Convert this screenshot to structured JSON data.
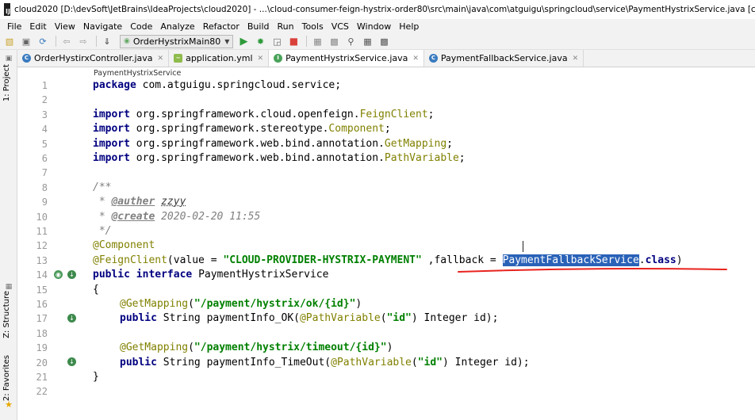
{
  "window": {
    "title": "cloud2020 [D:\\devSoft\\JetBrains\\IdeaProjects\\cloud2020] - ...\\cloud-consumer-feign-hystrix-order80\\src\\main\\java\\com\\atguigu\\springcloud\\service\\PaymentHystrixService.java [cloud-con"
  },
  "menu": [
    "File",
    "Edit",
    "View",
    "Navigate",
    "Code",
    "Analyze",
    "Refactor",
    "Build",
    "Run",
    "Tools",
    "VCS",
    "Window",
    "Help"
  ],
  "toolbar": {
    "run_config": "OrderHystrixMain80",
    "icons": [
      "open-folder-icon",
      "save-icon",
      "sync-icon",
      "back-arrow-icon",
      "forward-arrow-icon",
      "build-icon",
      "run-icon",
      "debug-icon",
      "coverage-icon",
      "stop-icon",
      "project-structure-icon",
      "sdk-icon",
      "search-icon",
      "grid-icon",
      "terminal-icon"
    ]
  },
  "side_tabs": {
    "project": "1: Project",
    "structure": "Z: Structure",
    "favorites": "2: Favorites"
  },
  "tabs": [
    {
      "label": "OrderHystirxController.java",
      "icon": "class-icon",
      "active": false
    },
    {
      "label": "application.yml",
      "icon": "yaml-icon",
      "active": false
    },
    {
      "label": "PaymentHystrixService.java",
      "icon": "interface-icon",
      "active": true
    },
    {
      "label": "PaymentFallbackService.java",
      "icon": "class-icon",
      "active": false
    }
  ],
  "breadcrumb": "PaymentHystrixService",
  "line_numbers": [
    "1",
    "2",
    "3",
    "4",
    "5",
    "6",
    "7",
    "8",
    "9",
    "10",
    "11",
    "12",
    "13",
    "14",
    "15",
    "16",
    "17",
    "18",
    "19",
    "20",
    "21",
    "22"
  ],
  "code": {
    "l1_kw": "package",
    "l1_rest": " com.atguigu.springcloud.service;",
    "imp": "import",
    "l3_a": " org.springframework.cloud.openfeign.",
    "l3_b": "FeignClient",
    "l3_c": ";",
    "l4_a": " org.springframework.stereotype.",
    "l4_b": "Component",
    "l4_c": ";",
    "l5_a": " org.springframework.web.bind.annotation.",
    "l5_b": "GetMapping",
    "l5_c": ";",
    "l6_a": " org.springframework.web.bind.annotation.",
    "l6_b": "PathVariable",
    "l6_c": ";",
    "l8": "/**",
    "l9_a": " * ",
    "l9_tag": "@auther",
    "l9_sp": " ",
    "l9_val": "zzyy",
    "l10_a": " * ",
    "l10_tag": "@create",
    "l10_val": " 2020-02-20 11:55",
    "l11": " */",
    "l12_a": "@C",
    "l12_b": "omponent",
    "l13_ann": "@FeignClient",
    "l13_a": "(value = ",
    "l13_str": "\"CLOUD-PROVIDER-HYSTRIX-PAYMENT\"",
    "l13_b": " ,fallback = ",
    "l13_sel": "PaymentFallbackService",
    "l13_c": ".",
    "l13_kw": "class",
    "l13_d": ")",
    "l14_kw1": "public",
    "l14_sp": " ",
    "l14_kw2": "interface",
    "l14_rest": " PaymentHystrixService",
    "l15": "{",
    "l16_ann": "@GetMapping",
    "l16_a": "(",
    "l16_str": "\"/payment/hystrix/ok/{id}\"",
    "l16_b": ")",
    "l17_kw": "public",
    "l17_a": " String paymentInfo_OK(",
    "l17_ann": "@PathVariable",
    "l17_b": "(",
    "l17_str": "\"id\"",
    "l17_c": ") Integer id);",
    "l19_ann": "@GetMapping",
    "l19_a": "(",
    "l19_str": "\"/payment/hystrix/timeout/{id}\"",
    "l19_b": ")",
    "l20_kw": "public",
    "l20_a": " String paymentInfo_TimeOut(",
    "l20_ann": "@PathVariable",
    "l20_b": "(",
    "l20_str": "\"id\"",
    "l20_c": ") Integer id);",
    "l21": "}"
  },
  "colors": {
    "keyword": "#000080",
    "annotation": "#808000",
    "string": "#008000",
    "comment": "#808080",
    "selection": "#2a62b8",
    "highlight_underline": "#e8231e"
  }
}
